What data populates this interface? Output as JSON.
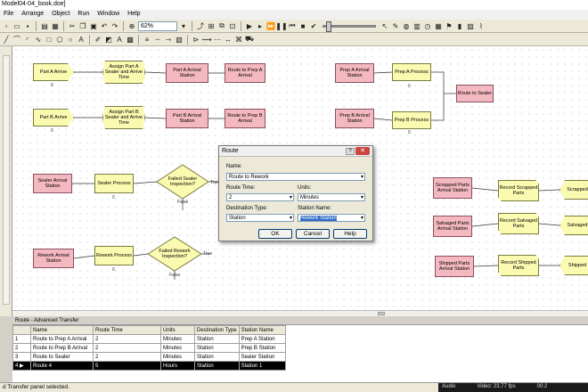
{
  "window": {
    "title": "Model04-04_book.doe]"
  },
  "menu": [
    "File",
    "Arrange",
    "Object",
    "Run",
    "Window",
    "Help"
  ],
  "toolbar": {
    "zoom": "62%"
  },
  "modules": [
    {
      "id": "m1",
      "label": "Part A Arrive",
      "kind": "create"
    },
    {
      "id": "m2",
      "label": "Assign Part A Sealer and Arrive Time",
      "kind": "assign"
    },
    {
      "id": "m3",
      "label": "Part A Arrival Station",
      "kind": "station"
    },
    {
      "id": "m4",
      "label": "Route to Prep A Arrival",
      "kind": "route"
    },
    {
      "id": "m5",
      "label": "Part B Arrive",
      "kind": "create"
    },
    {
      "id": "m6",
      "label": "Assign Part B Sealer and Arrive Time",
      "kind": "assign"
    },
    {
      "id": "m7",
      "label": "Part B Arrival Station",
      "kind": "station"
    },
    {
      "id": "m8",
      "label": "Route to Prep B Arrival",
      "kind": "route"
    },
    {
      "id": "m9",
      "label": "Prep A Arrival Station",
      "kind": "station"
    },
    {
      "id": "m10",
      "label": "Prep A Process",
      "kind": "process"
    },
    {
      "id": "m11",
      "label": "Route to Sealer",
      "kind": "route"
    },
    {
      "id": "m12",
      "label": "Prep B Arrival Station",
      "kind": "station"
    },
    {
      "id": "m13",
      "label": "Prep B Process",
      "kind": "process"
    },
    {
      "id": "m14",
      "label": "Sealer Arrival Station",
      "kind": "station"
    },
    {
      "id": "m15",
      "label": "Sealer Process",
      "kind": "process"
    },
    {
      "id": "m16",
      "label": "Failed Sealer Inspection?",
      "kind": "decide"
    },
    {
      "id": "m17",
      "label": "Rework Arrival Station",
      "kind": "station"
    },
    {
      "id": "m18",
      "label": "Rework Process",
      "kind": "process"
    },
    {
      "id": "m19",
      "label": "Failed Rework Inspection?",
      "kind": "decide"
    },
    {
      "id": "m20",
      "label": "Scrapped Parts Arrival Station",
      "kind": "station"
    },
    {
      "id": "m21",
      "label": "Record Scrapped Parts",
      "kind": "record"
    },
    {
      "id": "m22",
      "label": "Scrapped",
      "kind": "dispose"
    },
    {
      "id": "m23",
      "label": "Salvaged Parts Arrival Station",
      "kind": "station"
    },
    {
      "id": "m24",
      "label": "Record Salvaged Parts",
      "kind": "record"
    },
    {
      "id": "m25",
      "label": "Salvaged",
      "kind": "dispose"
    },
    {
      "id": "m26",
      "label": "Shipped Parts Arrival Station",
      "kind": "station"
    },
    {
      "id": "m27",
      "label": "Record Shipped Parts",
      "kind": "record"
    },
    {
      "id": "m28",
      "label": "Shipped",
      "kind": "dispose"
    }
  ],
  "counters": {
    "m1": "0",
    "m5": "0",
    "m10": "0",
    "m13": "0",
    "m15": "0",
    "m16_t": "True",
    "m16_f": "False",
    "m18": "0",
    "m19_t": "True",
    "m19_f": "False"
  },
  "dialog": {
    "title": "Route",
    "help_glyph": "?",
    "close_glyph": "✕",
    "name_label": "Name:",
    "name_value": "Route to Rework",
    "route_time_label": "Route Time:",
    "route_time_value": "2",
    "units_label": "Units:",
    "units_value": "Minutes",
    "dest_type_label": "Destination Type:",
    "dest_type_value": "Station",
    "station_name_label": "Station Name:",
    "station_name_value": "Rework Station",
    "ok": "OK",
    "cancel": "Cancel",
    "help": "Help"
  },
  "spreadsheet": {
    "title": "Route - Advanced Transfer",
    "columns": [
      "",
      "Name",
      "Route Time",
      "Units",
      "Destination Type",
      "Station Name"
    ],
    "rows": [
      [
        "1",
        "Route to Prep A Arrival",
        "2",
        "Minutes",
        "Station",
        "Prep A Station"
      ],
      [
        "2",
        "Route to Prep B Arrival",
        "2",
        "Minutes",
        "Station",
        "Prep B Station"
      ],
      [
        "3",
        "Route to Sealer",
        "2",
        "Minutes",
        "Station",
        "Sealer Station"
      ],
      [
        "4 ▶",
        "Route 4",
        "5",
        "Hours",
        "Station",
        "Station 1"
      ]
    ],
    "selected_row": 3
  },
  "status": {
    "text": "d Transfer panel selected."
  },
  "overlay": {
    "audio": "Audio",
    "video": "Video: 23.77 fps",
    "time": "00:2"
  }
}
